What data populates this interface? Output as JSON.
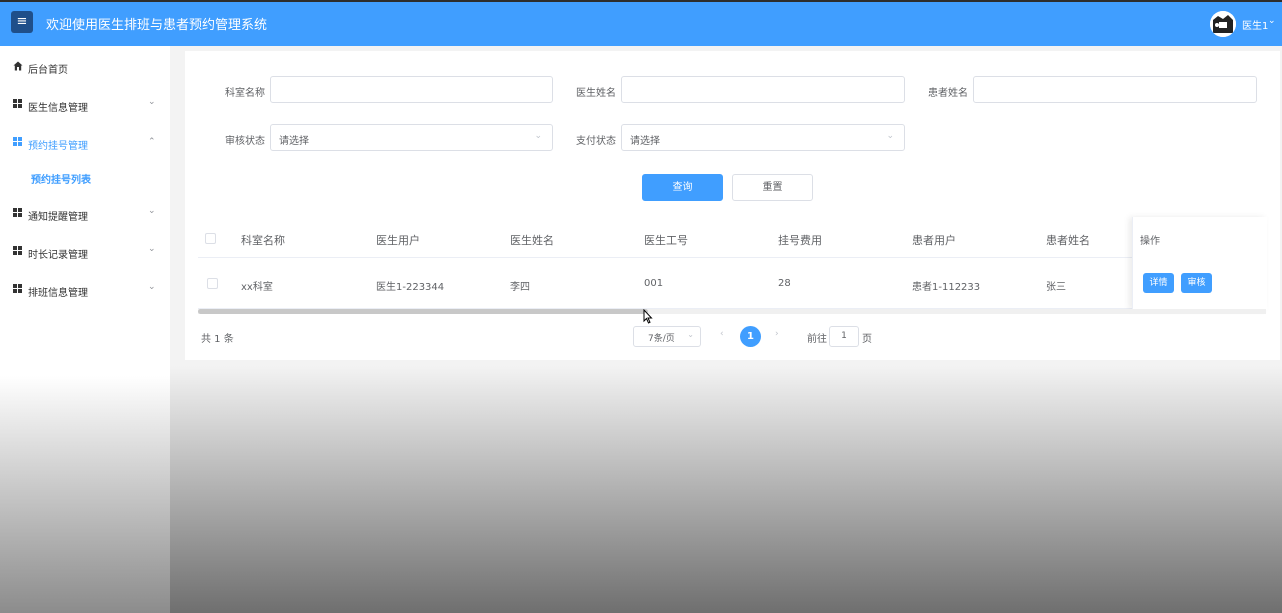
{
  "app": {
    "title": "欢迎使用医生排班与患者预约管理系统",
    "menu_icon": "hamburger-icon",
    "accent_color": "#409eff"
  },
  "user": {
    "name": "医生1"
  },
  "sidebar": {
    "items": [
      {
        "label": "后台首页",
        "icon": "home-icon"
      },
      {
        "label": "医生信息管理",
        "icon": "grid-icon"
      },
      {
        "label": "预约挂号管理",
        "icon": "grid-icon",
        "active": true
      },
      {
        "label": "通知提醒管理",
        "icon": "grid-icon"
      },
      {
        "label": "时长记录管理",
        "icon": "grid-icon"
      },
      {
        "label": "排班信息管理",
        "icon": "grid-icon"
      }
    ],
    "sub_item": "预约挂号列表"
  },
  "search": {
    "dept_label": "科室名称",
    "doctor_label": "医生姓名",
    "patient_label": "患者姓名",
    "audit_label": "审核状态",
    "audit_placeholder": "请选择",
    "pay_label": "支付状态",
    "pay_placeholder": "请选择",
    "query_label": "查询",
    "reset_label": "重置"
  },
  "table": {
    "columns": [
      "科室名称",
      "医生用户",
      "医生姓名",
      "医生工号",
      "挂号费用",
      "患者用户",
      "患者姓名"
    ],
    "operation_header": "操作",
    "rows": [
      {
        "cells": [
          "xx科室",
          "医生1-223344",
          "李四",
          "001",
          "28",
          "患者1-112233",
          "张三"
        ],
        "detail_label": "详情",
        "audit_label": "审核"
      }
    ]
  },
  "pagination": {
    "total_text": "共 1 条",
    "page_size": "7条/页",
    "current_page": "1",
    "goto_prefix": "前往",
    "goto_value": "1",
    "goto_suffix": "页"
  }
}
